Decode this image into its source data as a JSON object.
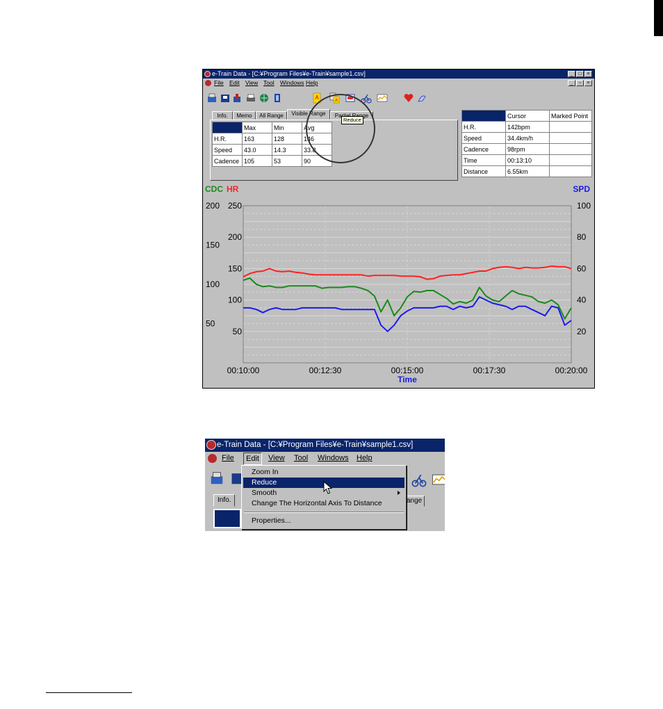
{
  "window_main": {
    "title": "e-Train Data - [C:¥Program Files¥e-Train¥sample1.csv]",
    "window_buttons": [
      "_",
      "□",
      "×"
    ],
    "child_buttons": [
      "_",
      "▫",
      "×"
    ],
    "menu": [
      "File",
      "Edit",
      "View",
      "Tool",
      "Windows",
      "Help"
    ],
    "tabs": [
      "Info.",
      "Memo",
      "All Range",
      "Visible Range",
      "Partial Range"
    ],
    "tooltip": "Reduce",
    "range_table": {
      "headers": [
        "",
        "Max",
        "Min",
        "Avg"
      ],
      "rows": [
        [
          "H.R.",
          "163",
          "128",
          "146"
        ],
        [
          "Speed",
          "43.0",
          "14.3",
          "33.8"
        ],
        [
          "Cadence",
          "105",
          "53",
          "90"
        ]
      ]
    },
    "cursor_table": {
      "headers": [
        "",
        "Cursor",
        "Marked Point"
      ],
      "rows": [
        [
          "H.R.",
          "142bpm",
          ""
        ],
        [
          "Speed",
          "34.4km/h",
          ""
        ],
        [
          "Cadence",
          "98rpm",
          ""
        ],
        [
          "Time",
          "00:13:10",
          ""
        ],
        [
          "Distance",
          "6.55km",
          ""
        ]
      ]
    }
  },
  "chart_data": {
    "type": "line",
    "xlabel": "Time",
    "x_ticks": [
      "00:10:00",
      "00:12:30",
      "00:15:00",
      "00:17:30",
      "00:20:00"
    ],
    "axis_labels": {
      "cdc": "CDC",
      "hr": "HR",
      "spd": "SPD"
    },
    "cdc_ticks": [
      200,
      150,
      100,
      50
    ],
    "hr_ticks": [
      250,
      200,
      150,
      100,
      50
    ],
    "spd_ticks": [
      100,
      80,
      60,
      40,
      20
    ],
    "hr_ylim": [
      0,
      250
    ],
    "cdc_ylim": [
      0,
      200
    ],
    "spd_ylim": [
      0,
      100
    ],
    "grid": true,
    "colors": {
      "hr": "#ff2020",
      "cdc": "#1a8a1a",
      "spd": "#1a1aee"
    },
    "t": [
      0,
      0.2,
      0.4,
      0.6,
      0.8,
      1,
      1.2,
      1.4,
      1.6,
      1.8,
      2,
      2.2,
      2.4,
      2.6,
      2.8,
      3,
      3.2,
      3.4,
      3.6,
      3.8,
      4,
      4.2,
      4.4,
      4.6,
      4.8,
      5,
      5.2,
      5.4,
      5.6,
      5.8,
      6,
      6.2,
      6.4,
      6.6,
      6.8,
      7,
      7.2,
      7.4,
      7.6,
      7.8,
      8,
      8.2,
      8.4,
      8.6,
      8.8,
      9,
      9.2,
      9.4,
      9.6,
      9.8,
      10
    ],
    "series": [
      {
        "name": "HR",
        "axis": "hr",
        "values": [
          137,
          142,
          145,
          146,
          150,
          146,
          145,
          146,
          144,
          143,
          141,
          140,
          140,
          140,
          140,
          140,
          140,
          140,
          140,
          138,
          139,
          139,
          139,
          139,
          138,
          138,
          138,
          137,
          133,
          134,
          138,
          139,
          140,
          140,
          142,
          144,
          146,
          146,
          150,
          152,
          153,
          152,
          150,
          152,
          151,
          151,
          152,
          154,
          153,
          153,
          150
        ]
      },
      {
        "name": "CDC",
        "axis": "cdc",
        "values": [
          105,
          108,
          100,
          97,
          98,
          96,
          96,
          98,
          98,
          98,
          98,
          98,
          95,
          96,
          96,
          96,
          97,
          97,
          95,
          92,
          85,
          65,
          80,
          60,
          70,
          84,
          91,
          90,
          92,
          92,
          87,
          82,
          75,
          78,
          76,
          80,
          96,
          85,
          80,
          78,
          85,
          92,
          88,
          86,
          84,
          78,
          76,
          80,
          74,
          56,
          70
        ]
      },
      {
        "name": "SPD",
        "axis": "spd",
        "values": [
          35,
          35,
          34,
          32,
          34,
          35,
          34,
          34,
          34,
          35,
          35,
          35,
          35,
          35,
          35,
          34,
          34,
          34,
          34,
          34,
          34,
          24,
          20,
          24,
          30,
          33,
          35,
          35,
          35,
          35,
          36,
          36,
          34,
          36,
          35,
          36,
          42,
          40,
          38,
          37,
          36,
          34,
          36,
          36,
          34,
          32,
          30,
          36,
          35,
          24,
          27
        ]
      }
    ]
  },
  "window_menu": {
    "title": "e-Train Data - [C:¥Program Files¥e-Train¥sample1.csv]",
    "menu": [
      "File",
      "Edit",
      "View",
      "Tool",
      "Windows",
      "Help"
    ],
    "tab_info": "Info.",
    "tab_range_fragment": "ange",
    "edit_menu_items": [
      "Zoom In",
      "Reduce",
      "Smooth",
      "Change The Horizontal Axis To Distance",
      "Properties..."
    ],
    "highlighted": "Reduce"
  }
}
